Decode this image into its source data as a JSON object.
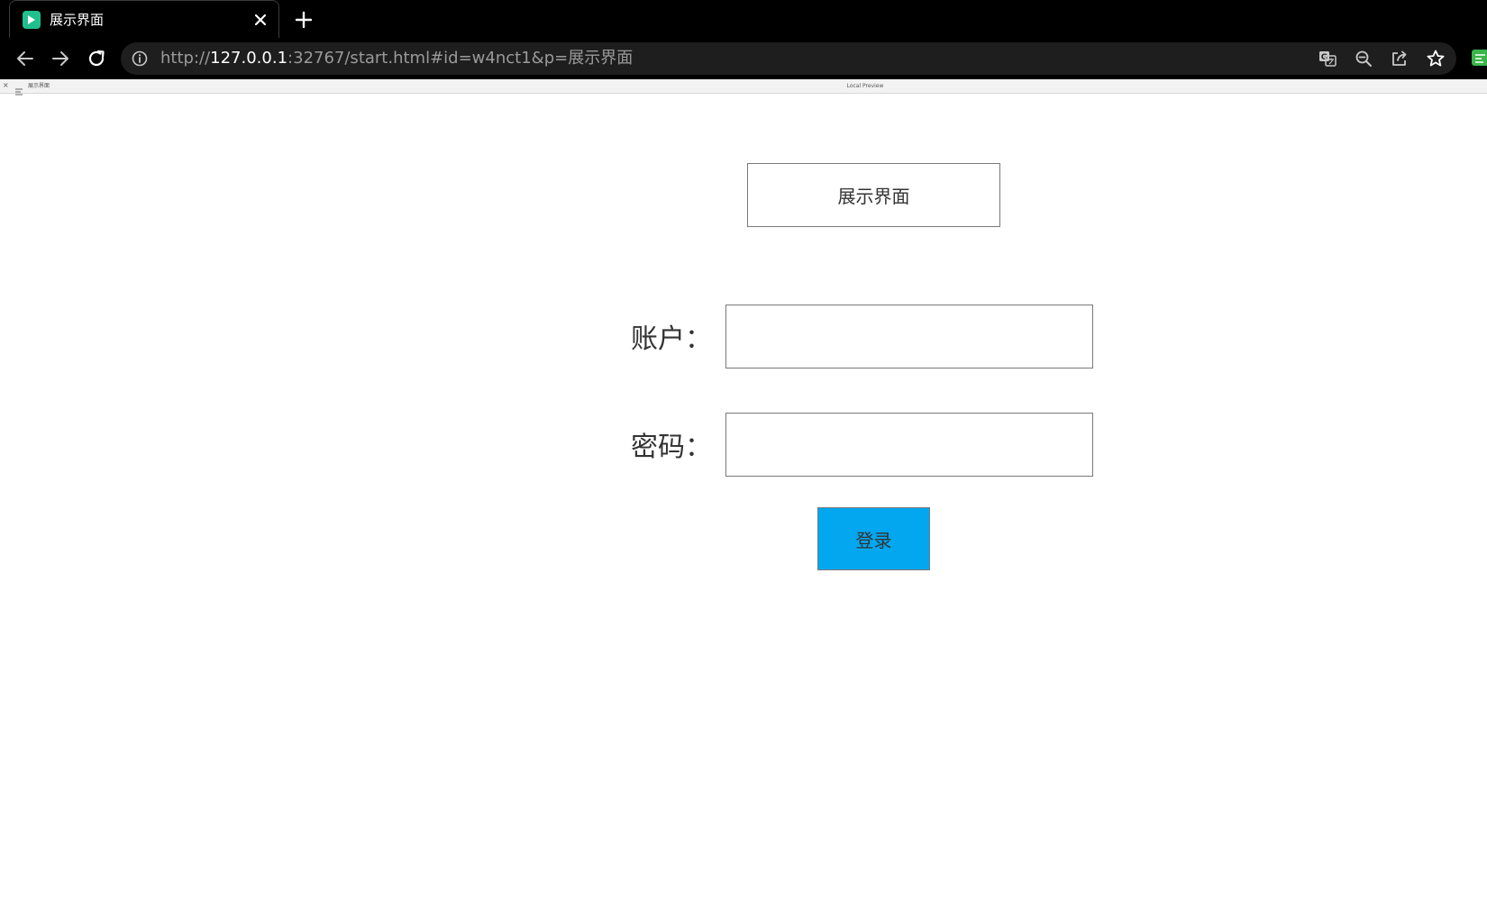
{
  "browser": {
    "tab": {
      "title": "展示界面"
    },
    "url": {
      "scheme": "http://",
      "host": "127.0.0.1",
      "rest": ":32767/start.html#id=w4nct1&p=展示界面"
    },
    "icons": {
      "favicon": "play-icon",
      "back": "arrow-left-icon",
      "forward": "arrow-right-icon",
      "reload": "reload-icon",
      "site_info": "info-icon",
      "translate": "translate-icon",
      "zoom": "zoom-out-icon",
      "share": "share-icon",
      "bookmark": "star-icon"
    }
  },
  "preview_strip": {
    "close": "×",
    "page": "展示界面",
    "center": "Local Preview"
  },
  "page": {
    "title": "展示界面",
    "account_label": "账户：",
    "account_value": "",
    "password_label": "密码：",
    "password_value": "",
    "login_label": "登录"
  },
  "colors": {
    "button_fill": "#02a7f0",
    "border": "#797979",
    "text": "#333333",
    "favicon": "#1fc08e"
  }
}
